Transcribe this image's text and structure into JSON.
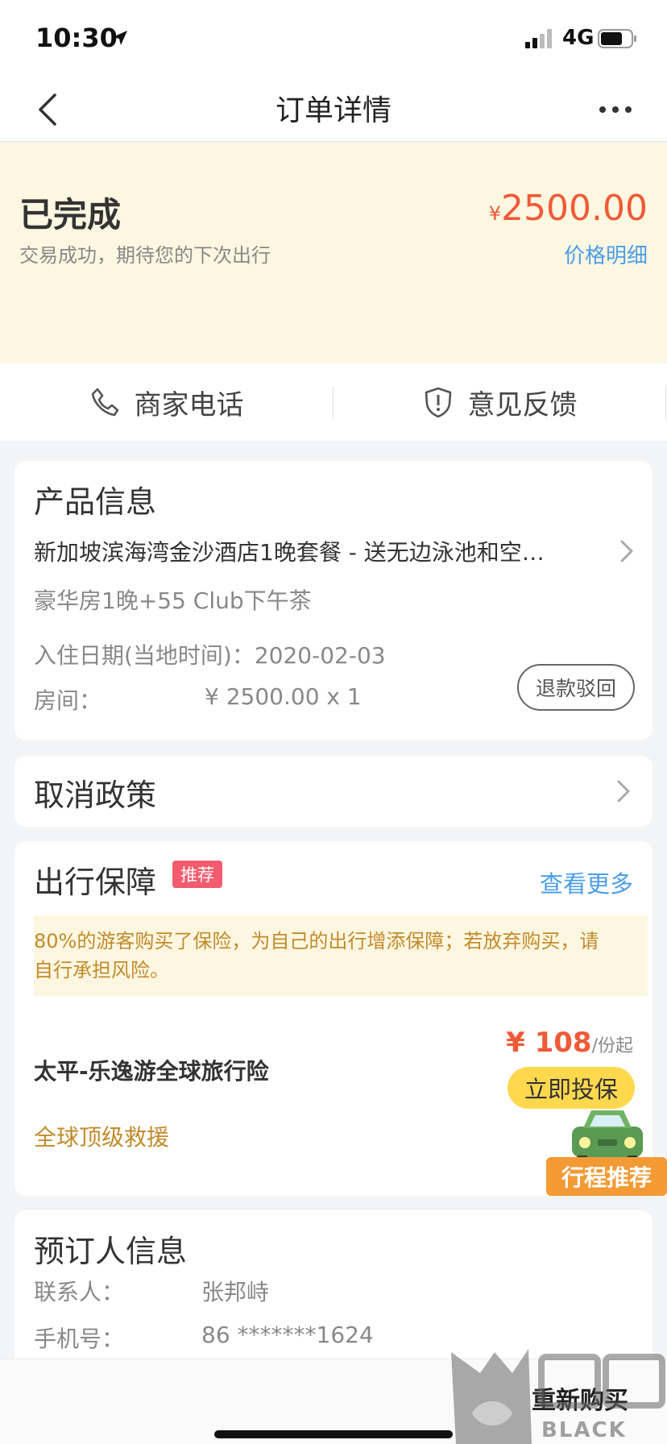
{
  "status_bar": {
    "time": "10:30",
    "network": "4G"
  },
  "nav": {
    "title": "订单详情"
  },
  "order": {
    "status": "已完成",
    "subtitle": "交易成功，期待您的下次出行",
    "currency_symbol": "¥",
    "amount": "2500.00",
    "price_detail_link": "价格明细"
  },
  "contact": {
    "merchant_phone": "商家电话",
    "feedback": "意见反馈"
  },
  "product": {
    "title": "产品信息",
    "name": "新加坡滨海湾金沙酒店1晚套餐 - 送无边泳池和空…",
    "room_type": "豪华房1晚+55 Club下午茶",
    "checkin": "入住日期(当地时间)：2020-02-03",
    "room_label": "房间：",
    "room_price": "¥ 2500.00 x 1",
    "refund_button": "退款驳回"
  },
  "cancel_policy": {
    "title": "取消政策"
  },
  "insurance": {
    "title": "出行保障",
    "badge": "推荐",
    "view_more": "查看更多",
    "notice_line1": "80%的游客购买了保险，为自己的出行增添保障；若放弃购买，请",
    "notice_line2": "自行承担风险。",
    "product_name": "太平-乐逸游全球旅行险",
    "price": "¥ 108",
    "price_unit": "/份起",
    "buy_button": "立即投保",
    "feature": "全球顶级救援"
  },
  "trip_widget": {
    "label": "行程推荐"
  },
  "booker": {
    "title": "预订人信息",
    "contact_label": "联系人：",
    "contact_name": "张邦峙",
    "phone_label": "手机号：",
    "phone_value": "86 *******1624"
  },
  "bottom": {
    "rebuy_button": "重新购买"
  },
  "watermark": {
    "text": "BLACK CAT"
  },
  "colors": {
    "price": "#ef5a37",
    "link": "#4a9ee8",
    "banner_bg": "#fdf7e1",
    "badge": "#f25c6e",
    "buy_button": "#ffd84e"
  }
}
